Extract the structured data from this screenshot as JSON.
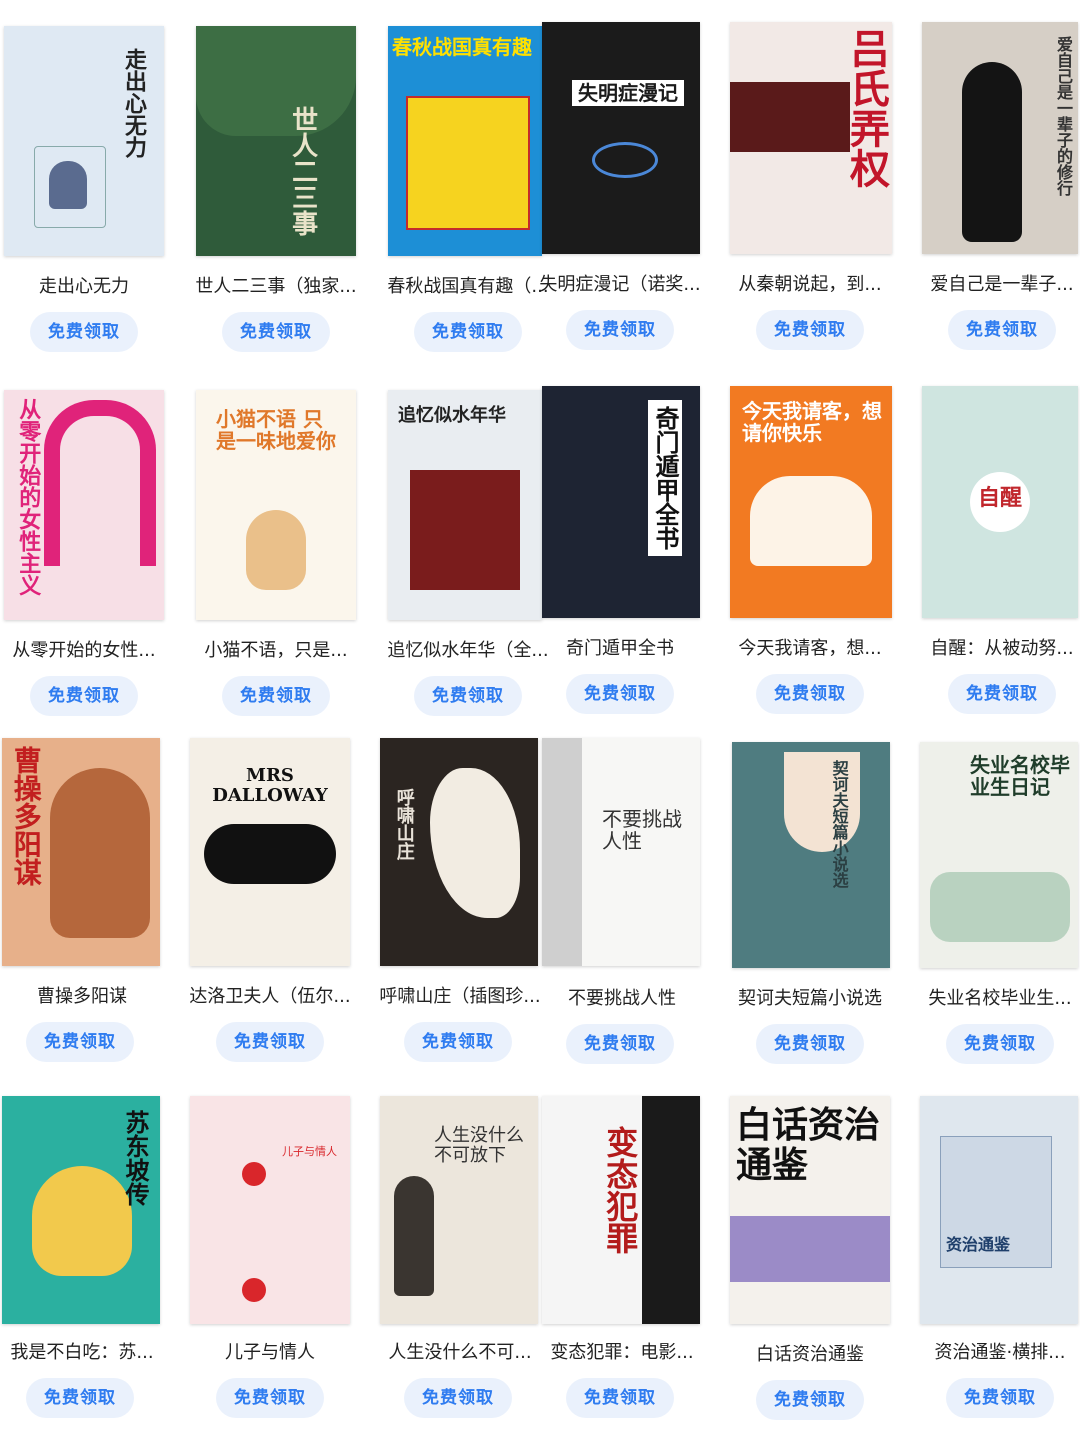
{
  "claim_label": "免费领取",
  "books": [
    {
      "title": "走出心无力",
      "cover_text": "走出心无力",
      "bg": "#dfe9f3",
      "fg": "#222222"
    },
    {
      "title": "世人二三事（独家...",
      "cover_text": "世人二三事",
      "bg": "#2f5b3a",
      "fg": "#e9e3c9"
    },
    {
      "title": "春秋战国真有趣（...",
      "cover_text": "春秋战国真有趣",
      "bg": "#1d8fd6",
      "fg": "#ffe000"
    },
    {
      "title": "失明症漫记（诺奖...",
      "cover_text": "失明症漫记",
      "bg": "#1b1b1b",
      "fg": "#ffffff"
    },
    {
      "title": "从秦朝说起，到...",
      "cover_text": "吕氏弄权",
      "bg": "#f2e9e6",
      "fg": "#c2152a"
    },
    {
      "title": "爱自己是一辈子...",
      "cover_text": "爱自己是一辈子的修行",
      "bg": "#d6cfc6",
      "fg": "#333333"
    },
    {
      "title": "从零开始的女性...",
      "cover_text": "从零开始的女性主义",
      "bg": "#f7dfe6",
      "fg": "#e0237a"
    },
    {
      "title": "小猫不语，只是...",
      "cover_text": "小猫不语 只是一味地爱你",
      "bg": "#fbf6ec",
      "fg": "#e0782a"
    },
    {
      "title": "追忆似水年华（全...",
      "cover_text": "追忆似水年华",
      "bg": "#e9edf1",
      "fg": "#222222"
    },
    {
      "title": "奇门遁甲全书",
      "cover_text": "奇门遁甲全书",
      "bg": "#1e2433",
      "fg": "#ffffff"
    },
    {
      "title": "今天我请客，想...",
      "cover_text": "今天我请客，想请你快乐",
      "bg": "#f27a22",
      "fg": "#ffffff"
    },
    {
      "title": "自醒：从被动努...",
      "cover_text": "自醒",
      "bg": "#cfe5e0",
      "fg": "#c1272d"
    },
    {
      "title": "曹操多阳谋",
      "cover_text": "曹操多阳谋",
      "bg": "#e7b08a",
      "fg": "#c21f1f"
    },
    {
      "title": "达洛卫夫人（伍尔...",
      "cover_text": "MRS DALLOWAY",
      "bg": "#f4efe6",
      "fg": "#111111"
    },
    {
      "title": "呼啸山庄（插图珍...",
      "cover_text": "呼啸山庄",
      "bg": "#2b2521",
      "fg": "#e8e2d8"
    },
    {
      "title": "不要挑战人性",
      "cover_text": "不要挑战人性",
      "bg": "#f7f7f5",
      "fg": "#333333"
    },
    {
      "title": "契诃夫短篇小说选",
      "cover_text": "契诃夫短篇小说选",
      "bg": "#4f7c80",
      "fg": "#f3e3d3"
    },
    {
      "title": "失业名校毕业生...",
      "cover_text": "失业名校毕业生日记",
      "bg": "#eef0ea",
      "fg": "#1f3d2a"
    },
    {
      "title": "我是不白吃：苏...",
      "cover_text": "苏东坡传",
      "bg": "#2bb0a0",
      "fg": "#ffe14a"
    },
    {
      "title": "儿子与情人",
      "cover_text": "儿子与情人",
      "bg": "#f9e4e6",
      "fg": "#d9262b"
    },
    {
      "title": "人生没什么不可...",
      "cover_text": "人生没什么不可放下",
      "bg": "#ece6dc",
      "fg": "#333333"
    },
    {
      "title": "变态犯罪：电影...",
      "cover_text": "变态犯罪",
      "bg": "#f5f5f5",
      "fg": "#b31b1b"
    },
    {
      "title": "白话资治通鉴",
      "cover_text": "白话资治通鉴",
      "bg": "#f4f1ec",
      "fg": "#111111"
    },
    {
      "title": "资治通鉴·横排...",
      "cover_text": "资治通鉴",
      "bg": "#dfe7ee",
      "fg": "#1f3f6b"
    }
  ]
}
